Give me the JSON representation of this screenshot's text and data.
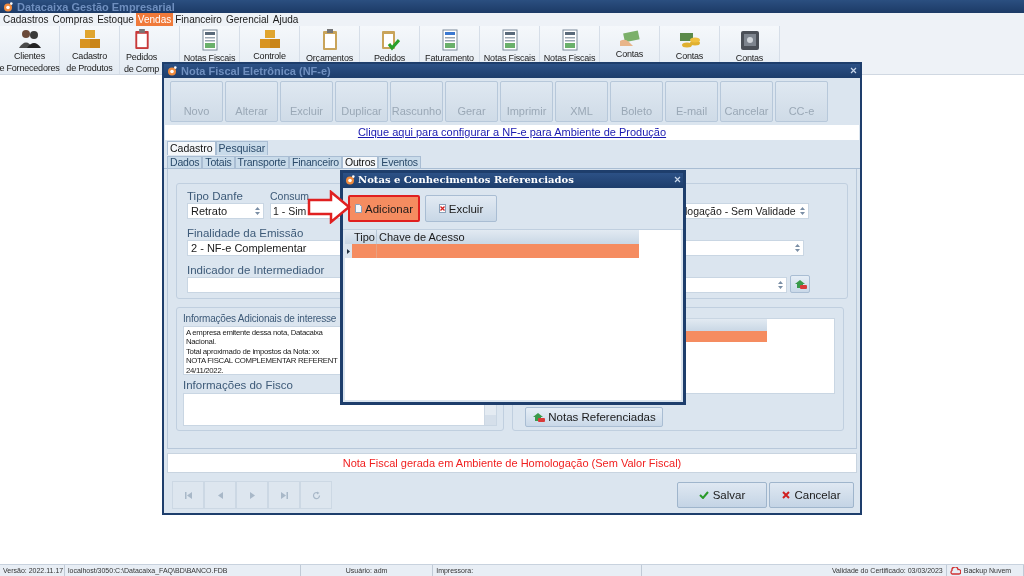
{
  "app_window": {
    "title": "Datacaixa Gestão Empresarial"
  },
  "menu": [
    {
      "label": "Cadastros",
      "selected": false
    },
    {
      "label": "Compras",
      "selected": false
    },
    {
      "label": "Estoque",
      "selected": false
    },
    {
      "label": "Vendas",
      "selected": true
    },
    {
      "label": "Financeiro",
      "selected": false
    },
    {
      "label": "Gerencial",
      "selected": false
    },
    {
      "label": "Ajuda",
      "selected": false
    }
  ],
  "toolbar": [
    {
      "lines": [
        "Clientes",
        "e Fornecedores"
      ]
    },
    {
      "lines": [
        "Cadastro",
        "de Produtos"
      ]
    },
    {
      "lines": [
        "Pedidos",
        "de Comp"
      ]
    },
    {
      "lines": [
        "Notas Fiscais"
      ]
    },
    {
      "lines": [
        "Controle"
      ]
    },
    {
      "lines": [
        "Orçamentos"
      ]
    },
    {
      "lines": [
        "Pedidos"
      ]
    },
    {
      "lines": [
        "Faturamento"
      ]
    },
    {
      "lines": [
        "Notas Fiscais"
      ]
    },
    {
      "lines": [
        "Notas Fiscais"
      ]
    },
    {
      "lines": [
        "Contas"
      ]
    },
    {
      "lines": [
        "Contas"
      ]
    },
    {
      "lines": [
        "Contas"
      ]
    }
  ],
  "nfe_window": {
    "title": "Nota Fiscal Eletrônica (NF-e)",
    "actions": [
      {
        "label": "Novo",
        "disabled": true
      },
      {
        "label": "Alterar",
        "disabled": true
      },
      {
        "label": "Excluir",
        "disabled": true
      },
      {
        "label": "Duplicar",
        "disabled": true
      },
      {
        "label": "Rascunho",
        "disabled": true
      },
      {
        "label": "Gerar",
        "disabled": true
      },
      {
        "label": "Imprimir",
        "disabled": true
      },
      {
        "label": "XML",
        "disabled": true
      },
      {
        "label": "Boleto",
        "disabled": true
      },
      {
        "label": "E-mail",
        "disabled": true
      },
      {
        "label": "Cancelar",
        "disabled": true
      },
      {
        "label": "CC-e",
        "disabled": true
      }
    ],
    "config_link": "Clique aqui para configurar a NF-e para Ambiente de Produção",
    "tabs": [
      {
        "label": "Cadastro",
        "selected": true
      },
      {
        "label": "Pesquisar",
        "selected": false
      }
    ],
    "subtabs": [
      {
        "label": "Dados",
        "selected": false
      },
      {
        "label": "Totais",
        "selected": false
      },
      {
        "label": "Transporte",
        "selected": false
      },
      {
        "label": "Financeiro",
        "selected": false
      },
      {
        "label": "Outros",
        "selected": true
      },
      {
        "label": "Eventos",
        "selected": false
      }
    ],
    "tipo_danfe": {
      "label": "Tipo Danfe",
      "value": "Retrato"
    },
    "consumidor_final": {
      "label": "Consum",
      "value": "1 - Sim"
    },
    "ambiente": {
      "value": "logação - Sem Validade"
    },
    "finalidade": {
      "label": "Finalidade da Emissão",
      "value": "2 - NF-e Complementar"
    },
    "intermediador": {
      "label": "Indicador de Intermediador"
    },
    "info_adicionais": {
      "label": "Informações Adicionais de interesse",
      "lines": [
        "A empresa emitente dessa nota, Datacaixa",
        "Nacional.",
        "Total aproximado de impostos da Nota:  xx",
        "NOTA FISCAL COMPLEMENTAR REFERENT",
        "24/11/2022."
      ]
    },
    "info_fisco": {
      "label": "Informações do Fisco"
    },
    "referenced_grid": {
      "rows": [
        {
          "selected": true
        }
      ]
    },
    "referenced_button": "Notas Referenciadas",
    "notice": "Nota Fiscal gerada em Ambiente de Homologação (Sem Valor Fiscal)",
    "buttons": [
      {
        "label": "Salvar",
        "kind": "save"
      },
      {
        "label": "Cancelar",
        "kind": "cancel"
      }
    ]
  },
  "dialog": {
    "title": "Notas e Conhecimentos Referenciados",
    "buttons": [
      {
        "label": "Adicionar",
        "highlighted": true,
        "kind": "add"
      },
      {
        "label": "Excluir",
        "highlighted": false,
        "kind": "delete"
      }
    ],
    "columns": [
      "Tipo",
      "Chave de Acesso"
    ],
    "rows": [
      {
        "selected": true
      }
    ]
  },
  "status_bar": [
    "Versão: 2022.11.17",
    "localhost/3050:C:\\Datacaixa_FAQ\\BD\\BANCO.FDB",
    "Usuário: adm",
    "Impressora:",
    "Validade do Certificado: 03/03/2023",
    "Backup Nuvem"
  ]
}
